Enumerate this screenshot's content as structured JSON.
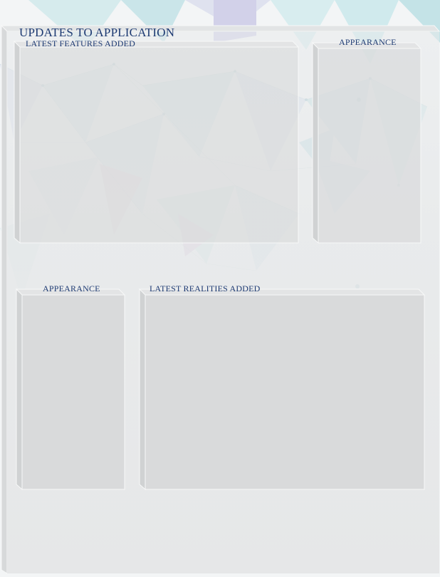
{
  "page": {
    "title": "UPDATES TO APPLICATION"
  },
  "panels": {
    "features": {
      "label": "LATEST FEATURES ADDED"
    },
    "appearance_top": {
      "label": "APPEARANCE"
    },
    "appearance_bottom": {
      "label": "APPEARANCE"
    },
    "realities": {
      "label": "LATEST REALITIES ADDED"
    }
  },
  "colors": {
    "heading": "#1d3a72",
    "panel_fill": "#d9dadb",
    "panel_edge": "#f6f7f7",
    "bevel": "#cfd1d2"
  }
}
